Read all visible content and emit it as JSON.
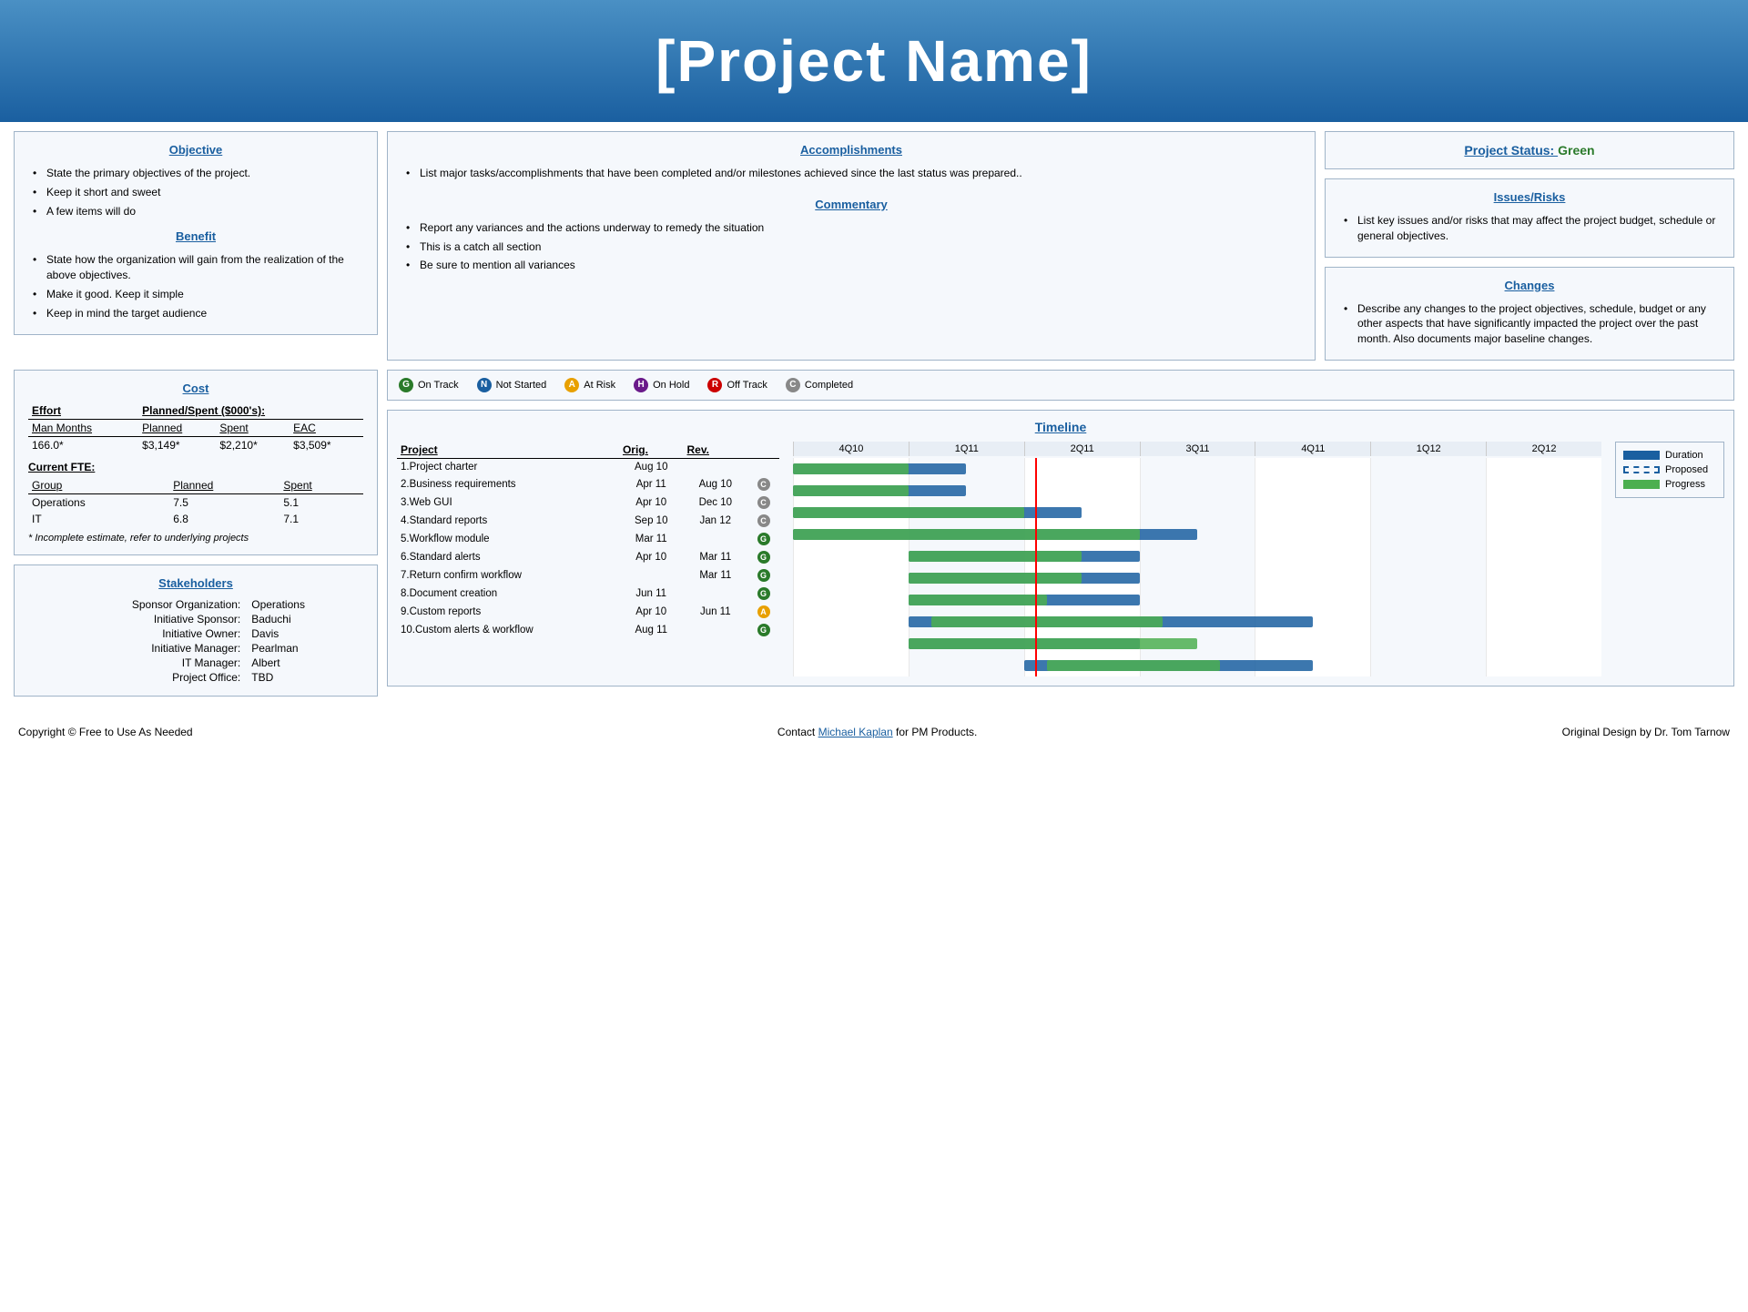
{
  "header": {
    "title": "[Project Name]"
  },
  "objective": {
    "title": "Objective",
    "items": [
      "State the primary objectives of the project.",
      "Keep it short and sweet",
      "A few items will do"
    ]
  },
  "benefit": {
    "title": "Benefit",
    "items": [
      "State how the organization will gain from the realization of the above objectives.",
      "Make it good. Keep it simple",
      "Keep in mind the target audience"
    ]
  },
  "accomplishments": {
    "title": "Accomplishments",
    "items": [
      "List major tasks/accomplishments that have been completed and/or milestones achieved since the last status was prepared.."
    ]
  },
  "commentary": {
    "title": "Commentary",
    "items": [
      "Report any variances and the actions underway to remedy the situation",
      "This is a catch all section",
      "Be sure to mention all variances"
    ]
  },
  "project_status": {
    "label": "Project Status: ",
    "value": "Green"
  },
  "issues_risks": {
    "title": "Issues/Risks",
    "items": [
      "List key issues and/or risks that may affect the project budget, schedule or general objectives."
    ]
  },
  "changes": {
    "title": "Changes",
    "items": [
      "Describe any changes to the project objectives, schedule, budget or any other aspects that have significantly impacted the project over the past month. Also documents major baseline changes."
    ]
  },
  "cost": {
    "title": "Cost",
    "effort_label": "Effort",
    "planned_spent_label": "Planned/Spent ($000's):",
    "columns": [
      "Man Months",
      "Planned",
      "Spent",
      "EAC"
    ],
    "row": [
      "166.0*",
      "$3,149*",
      "$2,210*",
      "$3,509*"
    ],
    "current_fte_label": "Current FTE:",
    "fte_columns": [
      "Group",
      "Planned",
      "Spent"
    ],
    "fte_rows": [
      [
        "Operations",
        "7.5",
        "5.1"
      ],
      [
        "IT",
        "6.8",
        "7.1"
      ]
    ],
    "footnote": "* Incomplete estimate, refer to underlying projects"
  },
  "stakeholders": {
    "title": "Stakeholders",
    "rows": [
      [
        "Sponsor Organization:",
        "Operations"
      ],
      [
        "Initiative Sponsor:",
        "Baduchi"
      ],
      [
        "Initiative Owner:",
        "Davis"
      ],
      [
        "Initiative Manager:",
        "Pearlman"
      ],
      [
        "IT Manager:",
        "Albert"
      ],
      [
        "Project Office:",
        "TBD"
      ]
    ]
  },
  "timeline": {
    "title": "Timeline",
    "legend": {
      "on_track": "On Track",
      "not_started": "Not Started",
      "at_risk": "At Risk",
      "on_hold": "On Hold",
      "off_track": "Off Track",
      "completed": "Completed"
    },
    "chart_legend": {
      "duration": "Duration",
      "proposed": "Proposed",
      "progress": "Progress"
    },
    "quarters": [
      "4Q10",
      "1Q11",
      "2Q11",
      "3Q11",
      "4Q11",
      "1Q12",
      "2Q12"
    ],
    "projects": [
      {
        "name": "1.Project charter",
        "orig": "Aug 10",
        "rev": "",
        "status": ""
      },
      {
        "name": "2.Business requirements",
        "orig": "Apr 11",
        "rev": "Aug 10",
        "status": "C"
      },
      {
        "name": "3.Web GUI",
        "orig": "Apr 10",
        "rev": "Dec 10",
        "status": "C"
      },
      {
        "name": "4.Standard reports",
        "orig": "Sep 10",
        "rev": "Jan 12",
        "status": "C"
      },
      {
        "name": "5.Workflow module",
        "orig": "Mar 11",
        "rev": "",
        "status": "G"
      },
      {
        "name": "6.Standard alerts",
        "orig": "Apr 10",
        "rev": "Mar 11",
        "status": "G"
      },
      {
        "name": "7.Return confirm workflow",
        "orig": "",
        "rev": "Mar 11",
        "status": "G"
      },
      {
        "name": "8.Document creation",
        "orig": "Jun 11",
        "rev": "",
        "status": "G"
      },
      {
        "name": "9.Custom reports",
        "orig": "Apr 10",
        "rev": "Jun 11",
        "status": "A"
      },
      {
        "name": "10.Custom alerts & workflow",
        "orig": "Aug 11",
        "rev": "",
        "status": "G"
      }
    ]
  },
  "footer": {
    "copyright": "Copyright © Free to Use As Needed",
    "contact_pre": "Contact ",
    "contact_name": "Michael Kaplan",
    "contact_post": " for PM Products.",
    "original_design": "Original Design by Dr. Tom Tarnow"
  }
}
